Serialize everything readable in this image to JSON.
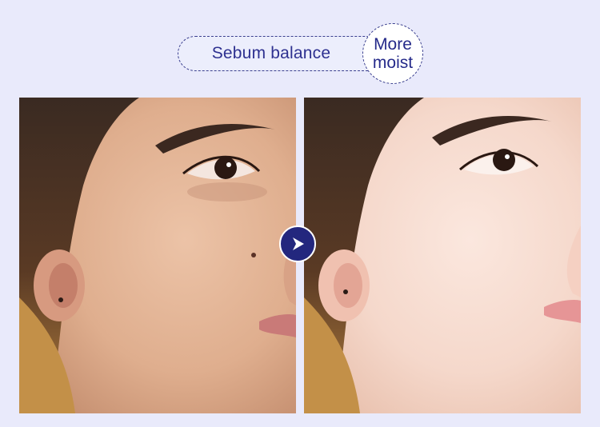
{
  "header": {
    "pill_label": "Sebum balance",
    "badge_line1": "More",
    "badge_line2": "moist"
  },
  "photos": {
    "before": {
      "icon": "face-before-photo"
    },
    "after": {
      "icon": "face-after-photo"
    }
  },
  "arrow": {
    "icon": "play-arrow-icon"
  },
  "colors": {
    "background": "#e9eafb",
    "accent": "#23277e",
    "text": "#2e3190"
  }
}
